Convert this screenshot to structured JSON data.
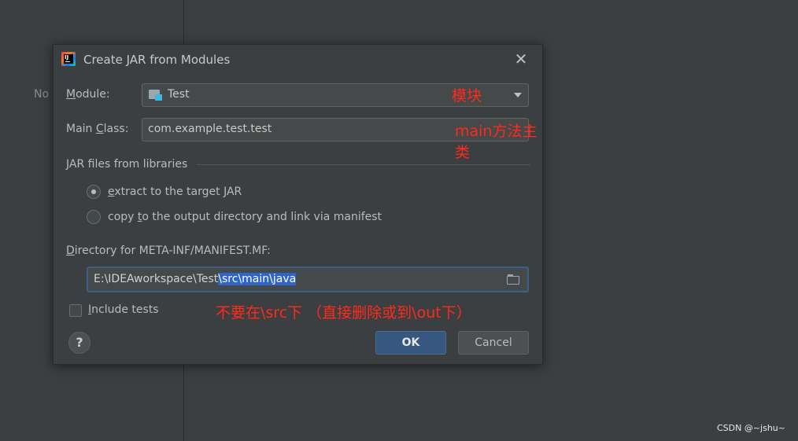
{
  "background": {
    "partial_text": "No",
    "watermark": "CSDN @~jshu~"
  },
  "dialog": {
    "title": "Create JAR from Modules",
    "app_icon_text": "IJ",
    "close_symbol": "✕"
  },
  "module": {
    "label_underlined": "M",
    "label_rest": "odule:",
    "value": "Test",
    "annotation": "模块"
  },
  "main_class": {
    "label_before": "Main ",
    "label_underlined": "C",
    "label_after": "lass:",
    "value": "com.example.test.test",
    "annotation": "main方法主类"
  },
  "jar_libraries": {
    "section_title": "JAR files from libraries",
    "options": [
      {
        "underlined": "e",
        "rest": "xtract to the target JAR",
        "selected": true
      },
      {
        "before": "copy ",
        "underlined": "t",
        "rest": "o the output directory and link via manifest",
        "selected": false
      }
    ]
  },
  "manifest_dir": {
    "label_underlined": "D",
    "label_rest": "irectory for META-INF/MANIFEST.MF:",
    "value_plain": "E:\\IDEAworkspace\\Test",
    "value_selected": "\\src\\main\\java"
  },
  "include_tests": {
    "label_underlined": "I",
    "label_rest": "nclude tests",
    "checked": false,
    "annotation": "不要在\\src下  （直接删除或到\\out下）"
  },
  "buttons": {
    "help": "?",
    "ok": "OK",
    "cancel": "Cancel"
  },
  "colors": {
    "annotation": "#ff2a1a",
    "selection": "#2f65ca",
    "ok_button": "#365880"
  }
}
